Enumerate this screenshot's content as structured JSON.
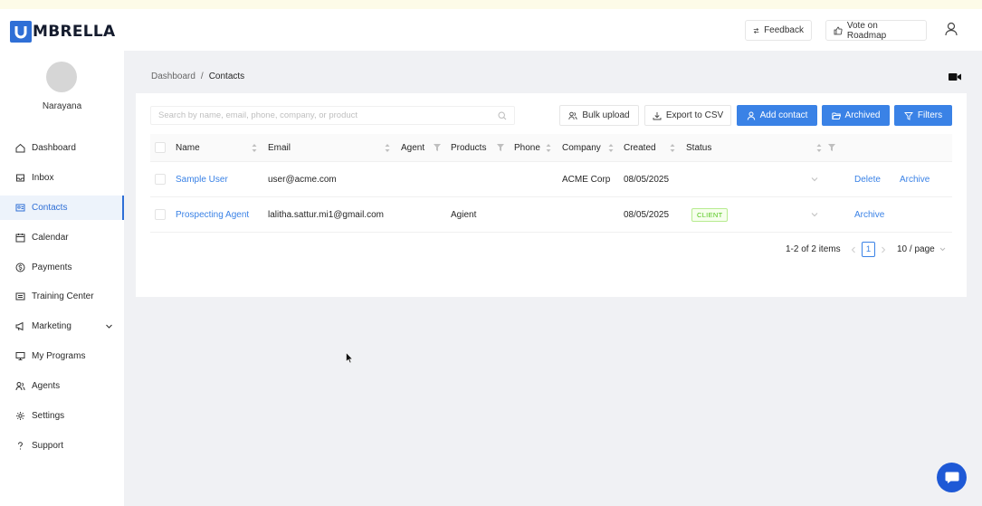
{
  "app": {
    "brand_letter": "U",
    "brand_rest": "MBRELLA"
  },
  "header": {
    "feedback_label": "Feedback",
    "roadmap_label": "Vote on Roadmap"
  },
  "sidebar": {
    "user_name": "Narayana",
    "items": [
      {
        "label": "Dashboard",
        "icon": "home-icon"
      },
      {
        "label": "Inbox",
        "icon": "inbox-icon"
      },
      {
        "label": "Contacts",
        "icon": "contacts-icon",
        "active": true
      },
      {
        "label": "Calendar",
        "icon": "calendar-icon"
      },
      {
        "label": "Payments",
        "icon": "dollar-icon"
      },
      {
        "label": "Training Center",
        "icon": "training-icon"
      },
      {
        "label": "Marketing",
        "icon": "megaphone-icon",
        "expandable": true
      },
      {
        "label": "My Programs",
        "icon": "monitor-icon"
      },
      {
        "label": "Agents",
        "icon": "agents-icon"
      },
      {
        "label": "Settings",
        "icon": "gear-icon"
      },
      {
        "label": "Support",
        "icon": "question-icon"
      }
    ]
  },
  "breadcrumb": {
    "root": "Dashboard",
    "separator": "/",
    "current": "Contacts"
  },
  "toolbar": {
    "search_placeholder": "Search by name, email, phone, company, or product",
    "bulk_upload": "Bulk upload",
    "export_csv": "Export to CSV",
    "add_contact": "Add contact",
    "archived": "Archived",
    "filters": "Filters"
  },
  "table": {
    "columns": {
      "name": "Name",
      "email": "Email",
      "agent": "Agent",
      "products": "Products",
      "phone": "Phone",
      "company": "Company",
      "created": "Created",
      "status": "Status"
    },
    "rows": [
      {
        "name": "Sample User",
        "email": "user@acme.com",
        "agent": "",
        "products": "",
        "phone": "",
        "company": "ACME Corp",
        "created": "08/05/2025",
        "status": "",
        "actions": [
          "Delete",
          "Archive"
        ]
      },
      {
        "name": "Prospecting Agent",
        "email": "lalitha.sattur.mi1@gmail.com",
        "agent": "",
        "products": "Agient",
        "phone": "",
        "company": "",
        "created": "08/05/2025",
        "status": "CLIENT",
        "actions": [
          "Archive"
        ]
      }
    ]
  },
  "pagination": {
    "summary": "1-2 of 2 items",
    "current_page": "1",
    "page_size": "10 / page"
  },
  "colors": {
    "primary": "#3a82e6",
    "brand": "#2f6fd6",
    "chat": "#1e59d6",
    "tag_green": "#52c41a"
  }
}
